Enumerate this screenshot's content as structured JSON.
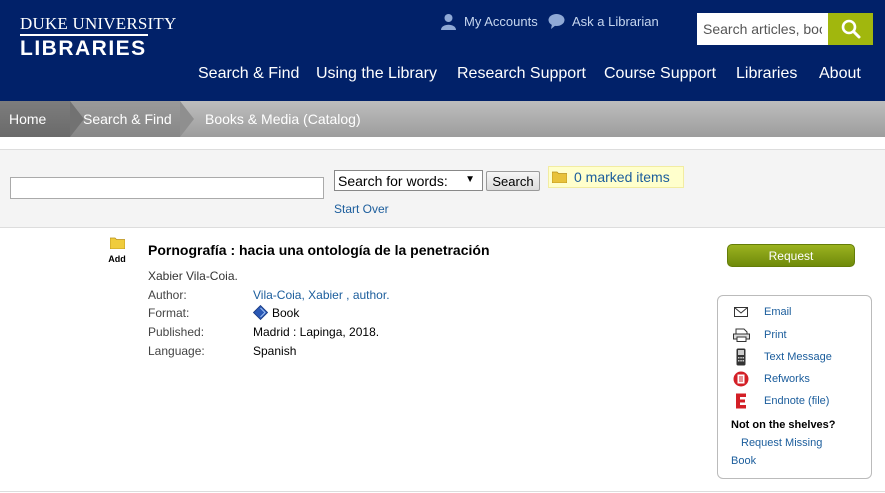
{
  "header": {
    "logo_line1": "DUKE UNIVERSITY",
    "logo_line2": "LIBRARIES",
    "my_accounts": "My Accounts",
    "ask_librarian": "Ask a Librarian",
    "search_placeholder": "Search articles, books",
    "nav": [
      "Search & Find",
      "Using the Library",
      "Research Support",
      "Course Support",
      "Libraries",
      "About"
    ],
    "colors": {
      "background": "#012169",
      "accent": "#a1b70d"
    }
  },
  "breadcrumb": [
    "Home",
    "Search & Find",
    "Books & Media (Catalog)"
  ],
  "search": {
    "input_value": "",
    "select_value": "Search for words:",
    "button": "Search",
    "marked_items": "0 marked items",
    "start_over": "Start Over"
  },
  "record": {
    "add_label": "Add",
    "title": "Pornografía : hacia una ontología de la penetración",
    "byline": "Xabier Vila-Coia.",
    "fields": [
      {
        "label": "Author:",
        "value": "Vila-Coia, Xabier , author."
      },
      {
        "label": "Format:",
        "value": "Book"
      },
      {
        "label": "Published:",
        "value": "Madrid : Lapinga, 2018."
      },
      {
        "label": "Language:",
        "value": "Spanish"
      }
    ]
  },
  "actions": {
    "request": "Request",
    "tools": [
      "Email",
      "Print",
      "Text Message",
      "Refworks",
      "Endnote (file)"
    ],
    "not_on_shelves": "Not on the shelves?",
    "request_missing_1": "Request Missing",
    "request_missing_2": "Book"
  }
}
